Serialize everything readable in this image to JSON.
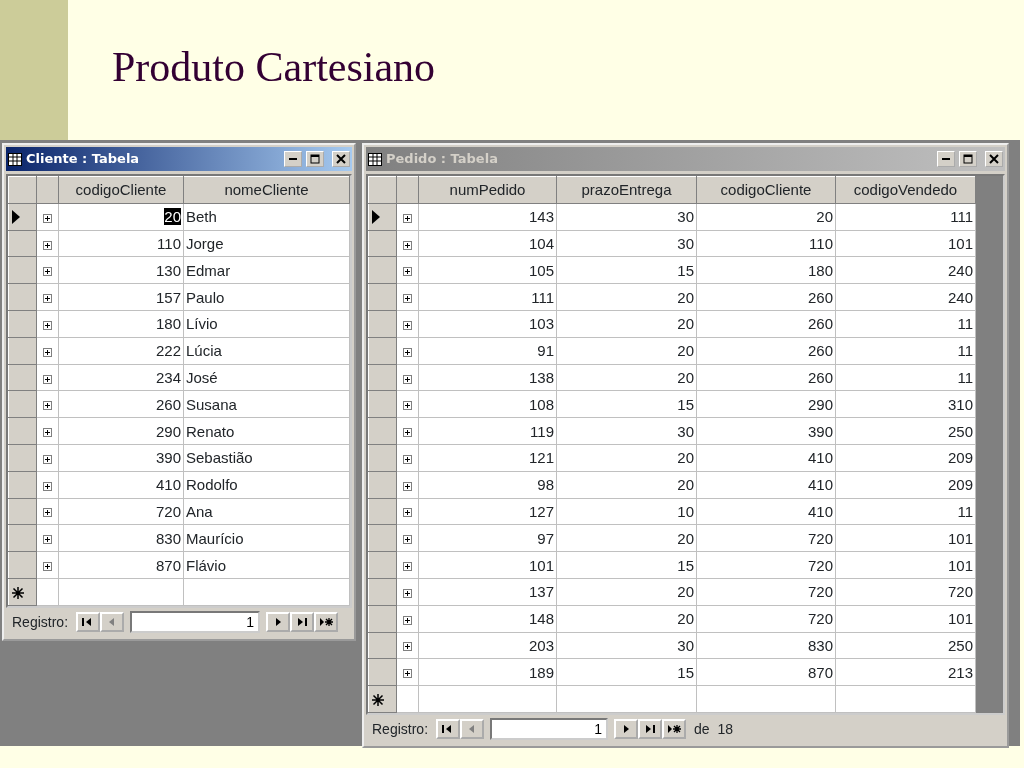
{
  "slide": {
    "title": "Produto Cartesiano"
  },
  "windows": [
    {
      "title": "Cliente : Tabela",
      "active": true,
      "columns": [
        {
          "label": "codigoCliente",
          "kind": "number"
        },
        {
          "label": "nomeCliente",
          "kind": "text"
        }
      ],
      "rows": [
        {
          "cells": [
            "20",
            "Beth"
          ],
          "current": true
        },
        {
          "cells": [
            "110",
            "Jorge"
          ],
          "current": false
        },
        {
          "cells": [
            "130",
            "Edmar"
          ],
          "current": false
        },
        {
          "cells": [
            "157",
            "Paulo"
          ],
          "current": false
        },
        {
          "cells": [
            "180",
            "Lívio"
          ],
          "current": false
        },
        {
          "cells": [
            "222",
            "Lúcia"
          ],
          "current": false
        },
        {
          "cells": [
            "234",
            "José"
          ],
          "current": false
        },
        {
          "cells": [
            "260",
            "Susana"
          ],
          "current": false
        },
        {
          "cells": [
            "290",
            "Renato"
          ],
          "current": false
        },
        {
          "cells": [
            "390",
            "Sebastião"
          ],
          "current": false
        },
        {
          "cells": [
            "410",
            "Rodolfo"
          ],
          "current": false
        },
        {
          "cells": [
            "720",
            "Ana"
          ],
          "current": false
        },
        {
          "cells": [
            "830",
            "Maurício"
          ],
          "current": false
        },
        {
          "cells": [
            "870",
            "Flávio"
          ],
          "current": false
        }
      ],
      "navigator": {
        "label": "Registro:",
        "record": "1"
      }
    },
    {
      "title": "Pedido : Tabela",
      "active": false,
      "columns": [
        {
          "label": "numPedido",
          "kind": "number"
        },
        {
          "label": "prazoEntrega",
          "kind": "number"
        },
        {
          "label": "codigoCliente",
          "kind": "number"
        },
        {
          "label": "codigoVendedo",
          "kind": "number"
        }
      ],
      "rows": [
        {
          "cells": [
            "143",
            "30",
            "20",
            "111"
          ],
          "current": true
        },
        {
          "cells": [
            "104",
            "30",
            "110",
            "101"
          ],
          "current": false
        },
        {
          "cells": [
            "105",
            "15",
            "180",
            "240"
          ],
          "current": false
        },
        {
          "cells": [
            "111",
            "20",
            "260",
            "240"
          ],
          "current": false
        },
        {
          "cells": [
            "103",
            "20",
            "260",
            "11"
          ],
          "current": false
        },
        {
          "cells": [
            "91",
            "20",
            "260",
            "11"
          ],
          "current": false
        },
        {
          "cells": [
            "138",
            "20",
            "260",
            "11"
          ],
          "current": false
        },
        {
          "cells": [
            "108",
            "15",
            "290",
            "310"
          ],
          "current": false
        },
        {
          "cells": [
            "119",
            "30",
            "390",
            "250"
          ],
          "current": false
        },
        {
          "cells": [
            "121",
            "20",
            "410",
            "209"
          ],
          "current": false
        },
        {
          "cells": [
            "98",
            "20",
            "410",
            "209"
          ],
          "current": false
        },
        {
          "cells": [
            "127",
            "10",
            "410",
            "11"
          ],
          "current": false
        },
        {
          "cells": [
            "97",
            "20",
            "720",
            "101"
          ],
          "current": false
        },
        {
          "cells": [
            "101",
            "15",
            "720",
            "101"
          ],
          "current": false
        },
        {
          "cells": [
            "137",
            "20",
            "720",
            "720"
          ],
          "current": false
        },
        {
          "cells": [
            "148",
            "20",
            "720",
            "101"
          ],
          "current": false
        },
        {
          "cells": [
            "203",
            "30",
            "830",
            "250"
          ],
          "current": false
        },
        {
          "cells": [
            "189",
            "15",
            "870",
            "213"
          ],
          "current": false
        }
      ],
      "navigator": {
        "label": "Registro:",
        "record": "1",
        "total": "de  18"
      }
    }
  ]
}
